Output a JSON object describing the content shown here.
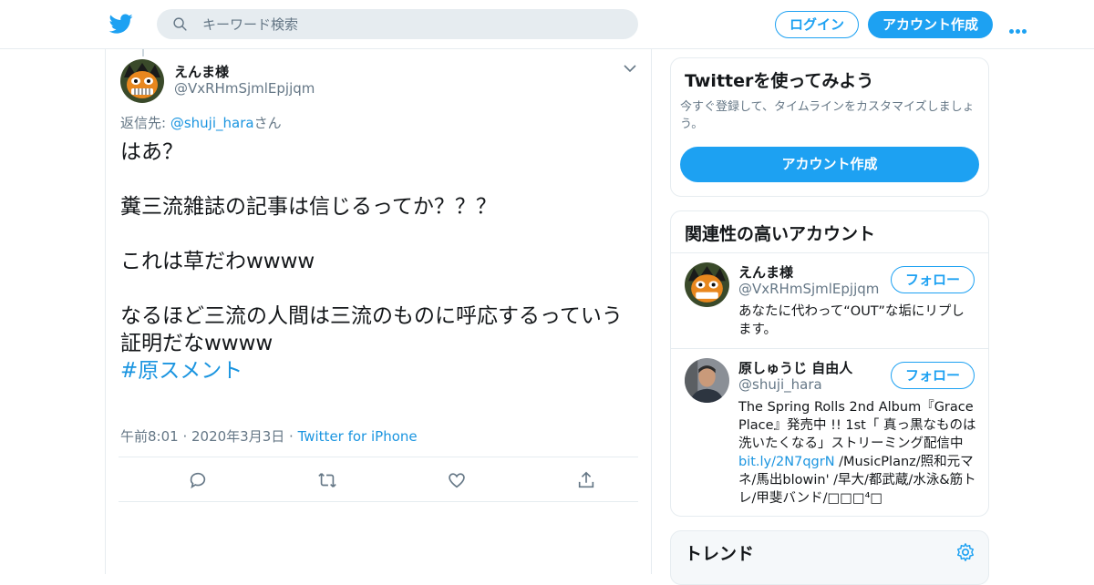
{
  "header": {
    "search_placeholder": "キーワード検索",
    "login_label": "ログイン",
    "signup_label": "アカウント作成"
  },
  "tweet": {
    "author_name": "えんま様",
    "author_handle": "@VxRHmSjmlEpjjqm",
    "replying_prefix": "返信先: ",
    "replying_to": "@shuji_hara",
    "replying_suffix": "さん",
    "text": "はあ？\n\n糞三流雑誌の記事は信じるってか？？？\n\nこれは草だわwwww\n\nなるほど三流の人間は三流のものに呼応するっていう証明だなwwww\n",
    "hashtag": "#原スメント",
    "time": "午前8:01 · 2020年3月3日 · ",
    "source": "Twitter for iPhone"
  },
  "signup_card": {
    "title": "Twitterを使ってみよう",
    "description": "今すぐ登録して、タイムラインをカスタマイズしましょう。",
    "cta_label": "アカウント作成"
  },
  "related": {
    "title": "関連性の高いアカウント",
    "accounts": [
      {
        "name": "えんま様",
        "handle": "@VxRHmSjmlEpjjqm",
        "follow_label": "フォロー",
        "bio": "あなたに代わって“OUT”な垢にリプします。"
      },
      {
        "name": "原しゅうじ 自由人",
        "handle": "@shuji_hara",
        "follow_label": "フォロー",
        "bio_before": "The Spring Rolls 2nd Album『Grace Place』発売中 !! 1st「 真っ黒なものは洗いたくなる」ストリーミング配信中 ",
        "bio_link": "bit.ly/2N7qgrN",
        "bio_after": " /MusicPlanz/照和元マネ/馬出blowin' /早大/都武蔵/水泳&筋トレ/甲斐バンド/□□□⁴□"
      }
    ]
  },
  "trends": {
    "title": "トレンド"
  },
  "colors": {
    "accent": "#1da1f2",
    "link": "#1b95e0",
    "muted": "#657786",
    "border": "#e6ecf0"
  }
}
